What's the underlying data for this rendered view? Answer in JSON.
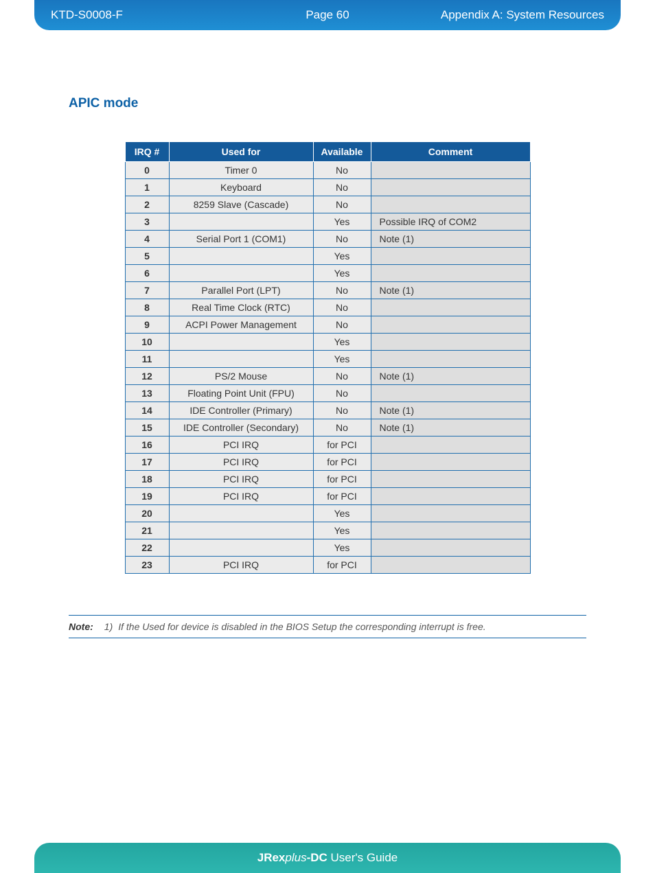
{
  "header": {
    "doc_id": "KTD-S0008-F",
    "page_label": "Page 60",
    "section": "Appendix A: System Resources"
  },
  "title": "APIC mode",
  "columns": {
    "irq": "IRQ #",
    "used": "Used for",
    "avail": "Available",
    "comment": "Comment"
  },
  "rows": [
    {
      "irq": "0",
      "used": "Timer 0",
      "avail": "No",
      "comment": ""
    },
    {
      "irq": "1",
      "used": "Keyboard",
      "avail": "No",
      "comment": ""
    },
    {
      "irq": "2",
      "used": "8259 Slave (Cascade)",
      "avail": "No",
      "comment": ""
    },
    {
      "irq": "3",
      "used": "",
      "avail": "Yes",
      "comment": "Possible IRQ of COM2"
    },
    {
      "irq": "4",
      "used": "Serial Port 1 (COM1)",
      "avail": "No",
      "comment": "Note (1)"
    },
    {
      "irq": "5",
      "used": "",
      "avail": "Yes",
      "comment": ""
    },
    {
      "irq": "6",
      "used": "",
      "avail": "Yes",
      "comment": ""
    },
    {
      "irq": "7",
      "used": "Parallel Port (LPT)",
      "avail": "No",
      "comment": "Note (1)"
    },
    {
      "irq": "8",
      "used": "Real Time Clock (RTC)",
      "avail": "No",
      "comment": ""
    },
    {
      "irq": "9",
      "used": "ACPI Power Management",
      "avail": "No",
      "comment": ""
    },
    {
      "irq": "10",
      "used": "",
      "avail": "Yes",
      "comment": ""
    },
    {
      "irq": "11",
      "used": "",
      "avail": "Yes",
      "comment": ""
    },
    {
      "irq": "12",
      "used": "PS/2 Mouse",
      "avail": "No",
      "comment": "Note (1)"
    },
    {
      "irq": "13",
      "used": "Floating Point Unit (FPU)",
      "avail": "No",
      "comment": ""
    },
    {
      "irq": "14",
      "used": "IDE Controller (Primary)",
      "avail": "No",
      "comment": "Note (1)"
    },
    {
      "irq": "15",
      "used": "IDE Controller (Secondary)",
      "avail": "No",
      "comment": "Note (1)"
    },
    {
      "irq": "16",
      "used": "PCI IRQ",
      "avail": "for PCI",
      "comment": ""
    },
    {
      "irq": "17",
      "used": "PCI IRQ",
      "avail": "for PCI",
      "comment": ""
    },
    {
      "irq": "18",
      "used": "PCI IRQ",
      "avail": "for PCI",
      "comment": ""
    },
    {
      "irq": "19",
      "used": "PCI IRQ",
      "avail": "for PCI",
      "comment": ""
    },
    {
      "irq": "20",
      "used": "",
      "avail": "Yes",
      "comment": ""
    },
    {
      "irq": "21",
      "used": "",
      "avail": "Yes",
      "comment": ""
    },
    {
      "irq": "22",
      "used": "",
      "avail": "Yes",
      "comment": ""
    },
    {
      "irq": "23",
      "used": "PCI IRQ",
      "avail": "for PCI",
      "comment": ""
    }
  ],
  "note": {
    "label": "Note:",
    "index": "1)",
    "text": "If the Used for device is disabled in the BIOS Setup the corresponding interrupt is free."
  },
  "footer": {
    "product_bold1": "JRex",
    "product_em": "plus",
    "product_bold2": "-DC",
    "rest": " User's Guide"
  }
}
